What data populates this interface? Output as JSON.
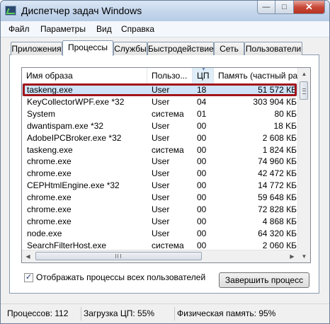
{
  "window": {
    "title": "Диспетчер задач Windows",
    "minimize": "—",
    "maximize": "□",
    "close": "✕"
  },
  "menu": [
    "Файл",
    "Параметры",
    "Вид",
    "Справка"
  ],
  "tabs": [
    {
      "label": "Приложения",
      "active": false
    },
    {
      "label": "Процессы",
      "active": true
    },
    {
      "label": "Службы",
      "active": false
    },
    {
      "label": "Быстродействие",
      "active": false
    },
    {
      "label": "Сеть",
      "active": false
    },
    {
      "label": "Пользователи",
      "active": false
    }
  ],
  "table": {
    "columns": {
      "name": "Имя образа",
      "user": "Пользо...",
      "cpu": "ЦП",
      "memory": "Память (частный ра..."
    },
    "sorted_column": "cpu",
    "rows": [
      {
        "name": "taskeng.exe",
        "user": "User",
        "cpu": "18",
        "memory": "51 572 КБ"
      },
      {
        "name": "KeyCollectorWPF.exe *32",
        "user": "User",
        "cpu": "04",
        "memory": "303 904 КБ"
      },
      {
        "name": "System",
        "user": "система",
        "cpu": "01",
        "memory": "80 КБ"
      },
      {
        "name": "dwantispam.exe *32",
        "user": "User",
        "cpu": "00",
        "memory": "18 KБ"
      },
      {
        "name": "AdobeIPCBroker.exe *32",
        "user": "User",
        "cpu": "00",
        "memory": "2 608 КБ"
      },
      {
        "name": "taskeng.exe",
        "user": "система",
        "cpu": "00",
        "memory": "1 824 КБ"
      },
      {
        "name": "chrome.exe",
        "user": "User",
        "cpu": "00",
        "memory": "74 960 КБ"
      },
      {
        "name": "chrome.exe",
        "user": "User",
        "cpu": "00",
        "memory": "42 472 КБ"
      },
      {
        "name": "CEPHtmlEngine.exe *32",
        "user": "User",
        "cpu": "00",
        "memory": "14 772 КБ"
      },
      {
        "name": "chrome.exe",
        "user": "User",
        "cpu": "00",
        "memory": "59 648 КБ"
      },
      {
        "name": "chrome.exe",
        "user": "User",
        "cpu": "00",
        "memory": "72 828 КБ"
      },
      {
        "name": "chrome.exe",
        "user": "User",
        "cpu": "00",
        "memory": "4 868 КБ"
      },
      {
        "name": "node.exe",
        "user": "User",
        "cpu": "00",
        "memory": "64 320 КБ"
      },
      {
        "name": "SearchFilterHost.exe",
        "user": "система",
        "cpu": "00",
        "memory": "2 060 КБ"
      }
    ],
    "selected_row_index": 0
  },
  "show_all_users": {
    "label": "Отображать процессы всех пользователей",
    "checked": true,
    "mark": "✓"
  },
  "end_process_label": "Завершить процесс",
  "status": {
    "processes": "Процессов: 112",
    "cpu": "Загрузка ЦП: 55%",
    "memory": "Физическая память: 95%"
  },
  "colors": {
    "highlight_border": "#a3141a",
    "selected_row": "#cfe4f8"
  }
}
